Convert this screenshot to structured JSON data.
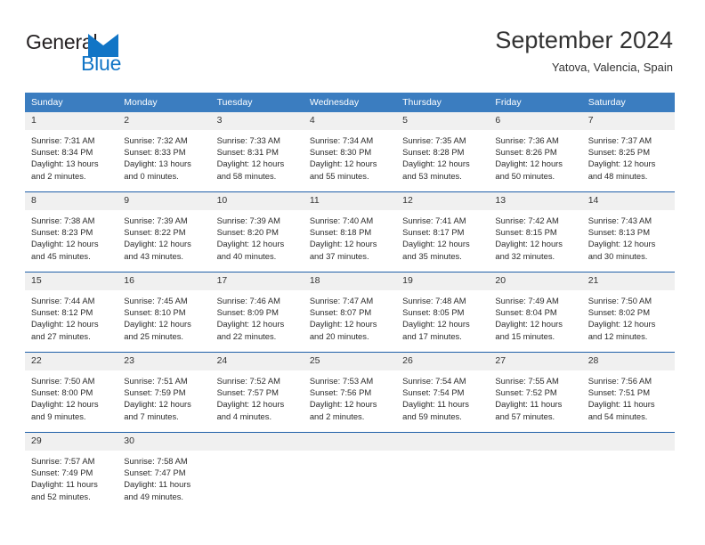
{
  "brand": {
    "name_part1": "General",
    "name_part2": "Blue",
    "accent_color": "#1175c6",
    "logo_icon": "triangle-logo-icon"
  },
  "header": {
    "title": "September 2024",
    "subtitle": "Yatova, Valencia, Spain"
  },
  "calendar": {
    "header_color": "#3b7dc0",
    "separator_color": "#1f5fa8",
    "daynum_band_color": "#f0f0f0",
    "weekdays": [
      "Sunday",
      "Monday",
      "Tuesday",
      "Wednesday",
      "Thursday",
      "Friday",
      "Saturday"
    ],
    "weeks": [
      [
        {
          "day": "1",
          "sunrise": "Sunrise: 7:31 AM",
          "sunset": "Sunset: 8:34 PM",
          "daylight_line1": "Daylight: 13 hours",
          "daylight_line2": "and 2 minutes."
        },
        {
          "day": "2",
          "sunrise": "Sunrise: 7:32 AM",
          "sunset": "Sunset: 8:33 PM",
          "daylight_line1": "Daylight: 13 hours",
          "daylight_line2": "and 0 minutes."
        },
        {
          "day": "3",
          "sunrise": "Sunrise: 7:33 AM",
          "sunset": "Sunset: 8:31 PM",
          "daylight_line1": "Daylight: 12 hours",
          "daylight_line2": "and 58 minutes."
        },
        {
          "day": "4",
          "sunrise": "Sunrise: 7:34 AM",
          "sunset": "Sunset: 8:30 PM",
          "daylight_line1": "Daylight: 12 hours",
          "daylight_line2": "and 55 minutes."
        },
        {
          "day": "5",
          "sunrise": "Sunrise: 7:35 AM",
          "sunset": "Sunset: 8:28 PM",
          "daylight_line1": "Daylight: 12 hours",
          "daylight_line2": "and 53 minutes."
        },
        {
          "day": "6",
          "sunrise": "Sunrise: 7:36 AM",
          "sunset": "Sunset: 8:26 PM",
          "daylight_line1": "Daylight: 12 hours",
          "daylight_line2": "and 50 minutes."
        },
        {
          "day": "7",
          "sunrise": "Sunrise: 7:37 AM",
          "sunset": "Sunset: 8:25 PM",
          "daylight_line1": "Daylight: 12 hours",
          "daylight_line2": "and 48 minutes."
        }
      ],
      [
        {
          "day": "8",
          "sunrise": "Sunrise: 7:38 AM",
          "sunset": "Sunset: 8:23 PM",
          "daylight_line1": "Daylight: 12 hours",
          "daylight_line2": "and 45 minutes."
        },
        {
          "day": "9",
          "sunrise": "Sunrise: 7:39 AM",
          "sunset": "Sunset: 8:22 PM",
          "daylight_line1": "Daylight: 12 hours",
          "daylight_line2": "and 43 minutes."
        },
        {
          "day": "10",
          "sunrise": "Sunrise: 7:39 AM",
          "sunset": "Sunset: 8:20 PM",
          "daylight_line1": "Daylight: 12 hours",
          "daylight_line2": "and 40 minutes."
        },
        {
          "day": "11",
          "sunrise": "Sunrise: 7:40 AM",
          "sunset": "Sunset: 8:18 PM",
          "daylight_line1": "Daylight: 12 hours",
          "daylight_line2": "and 37 minutes."
        },
        {
          "day": "12",
          "sunrise": "Sunrise: 7:41 AM",
          "sunset": "Sunset: 8:17 PM",
          "daylight_line1": "Daylight: 12 hours",
          "daylight_line2": "and 35 minutes."
        },
        {
          "day": "13",
          "sunrise": "Sunrise: 7:42 AM",
          "sunset": "Sunset: 8:15 PM",
          "daylight_line1": "Daylight: 12 hours",
          "daylight_line2": "and 32 minutes."
        },
        {
          "day": "14",
          "sunrise": "Sunrise: 7:43 AM",
          "sunset": "Sunset: 8:13 PM",
          "daylight_line1": "Daylight: 12 hours",
          "daylight_line2": "and 30 minutes."
        }
      ],
      [
        {
          "day": "15",
          "sunrise": "Sunrise: 7:44 AM",
          "sunset": "Sunset: 8:12 PM",
          "daylight_line1": "Daylight: 12 hours",
          "daylight_line2": "and 27 minutes."
        },
        {
          "day": "16",
          "sunrise": "Sunrise: 7:45 AM",
          "sunset": "Sunset: 8:10 PM",
          "daylight_line1": "Daylight: 12 hours",
          "daylight_line2": "and 25 minutes."
        },
        {
          "day": "17",
          "sunrise": "Sunrise: 7:46 AM",
          "sunset": "Sunset: 8:09 PM",
          "daylight_line1": "Daylight: 12 hours",
          "daylight_line2": "and 22 minutes."
        },
        {
          "day": "18",
          "sunrise": "Sunrise: 7:47 AM",
          "sunset": "Sunset: 8:07 PM",
          "daylight_line1": "Daylight: 12 hours",
          "daylight_line2": "and 20 minutes."
        },
        {
          "day": "19",
          "sunrise": "Sunrise: 7:48 AM",
          "sunset": "Sunset: 8:05 PM",
          "daylight_line1": "Daylight: 12 hours",
          "daylight_line2": "and 17 minutes."
        },
        {
          "day": "20",
          "sunrise": "Sunrise: 7:49 AM",
          "sunset": "Sunset: 8:04 PM",
          "daylight_line1": "Daylight: 12 hours",
          "daylight_line2": "and 15 minutes."
        },
        {
          "day": "21",
          "sunrise": "Sunrise: 7:50 AM",
          "sunset": "Sunset: 8:02 PM",
          "daylight_line1": "Daylight: 12 hours",
          "daylight_line2": "and 12 minutes."
        }
      ],
      [
        {
          "day": "22",
          "sunrise": "Sunrise: 7:50 AM",
          "sunset": "Sunset: 8:00 PM",
          "daylight_line1": "Daylight: 12 hours",
          "daylight_line2": "and 9 minutes."
        },
        {
          "day": "23",
          "sunrise": "Sunrise: 7:51 AM",
          "sunset": "Sunset: 7:59 PM",
          "daylight_line1": "Daylight: 12 hours",
          "daylight_line2": "and 7 minutes."
        },
        {
          "day": "24",
          "sunrise": "Sunrise: 7:52 AM",
          "sunset": "Sunset: 7:57 PM",
          "daylight_line1": "Daylight: 12 hours",
          "daylight_line2": "and 4 minutes."
        },
        {
          "day": "25",
          "sunrise": "Sunrise: 7:53 AM",
          "sunset": "Sunset: 7:56 PM",
          "daylight_line1": "Daylight: 12 hours",
          "daylight_line2": "and 2 minutes."
        },
        {
          "day": "26",
          "sunrise": "Sunrise: 7:54 AM",
          "sunset": "Sunset: 7:54 PM",
          "daylight_line1": "Daylight: 11 hours",
          "daylight_line2": "and 59 minutes."
        },
        {
          "day": "27",
          "sunrise": "Sunrise: 7:55 AM",
          "sunset": "Sunset: 7:52 PM",
          "daylight_line1": "Daylight: 11 hours",
          "daylight_line2": "and 57 minutes."
        },
        {
          "day": "28",
          "sunrise": "Sunrise: 7:56 AM",
          "sunset": "Sunset: 7:51 PM",
          "daylight_line1": "Daylight: 11 hours",
          "daylight_line2": "and 54 minutes."
        }
      ],
      [
        {
          "day": "29",
          "sunrise": "Sunrise: 7:57 AM",
          "sunset": "Sunset: 7:49 PM",
          "daylight_line1": "Daylight: 11 hours",
          "daylight_line2": "and 52 minutes."
        },
        {
          "day": "30",
          "sunrise": "Sunrise: 7:58 AM",
          "sunset": "Sunset: 7:47 PM",
          "daylight_line1": "Daylight: 11 hours",
          "daylight_line2": "and 49 minutes."
        },
        {
          "day": "",
          "sunrise": "",
          "sunset": "",
          "daylight_line1": "",
          "daylight_line2": ""
        },
        {
          "day": "",
          "sunrise": "",
          "sunset": "",
          "daylight_line1": "",
          "daylight_line2": ""
        },
        {
          "day": "",
          "sunrise": "",
          "sunset": "",
          "daylight_line1": "",
          "daylight_line2": ""
        },
        {
          "day": "",
          "sunrise": "",
          "sunset": "",
          "daylight_line1": "",
          "daylight_line2": ""
        },
        {
          "day": "",
          "sunrise": "",
          "sunset": "",
          "daylight_line1": "",
          "daylight_line2": ""
        }
      ]
    ]
  }
}
